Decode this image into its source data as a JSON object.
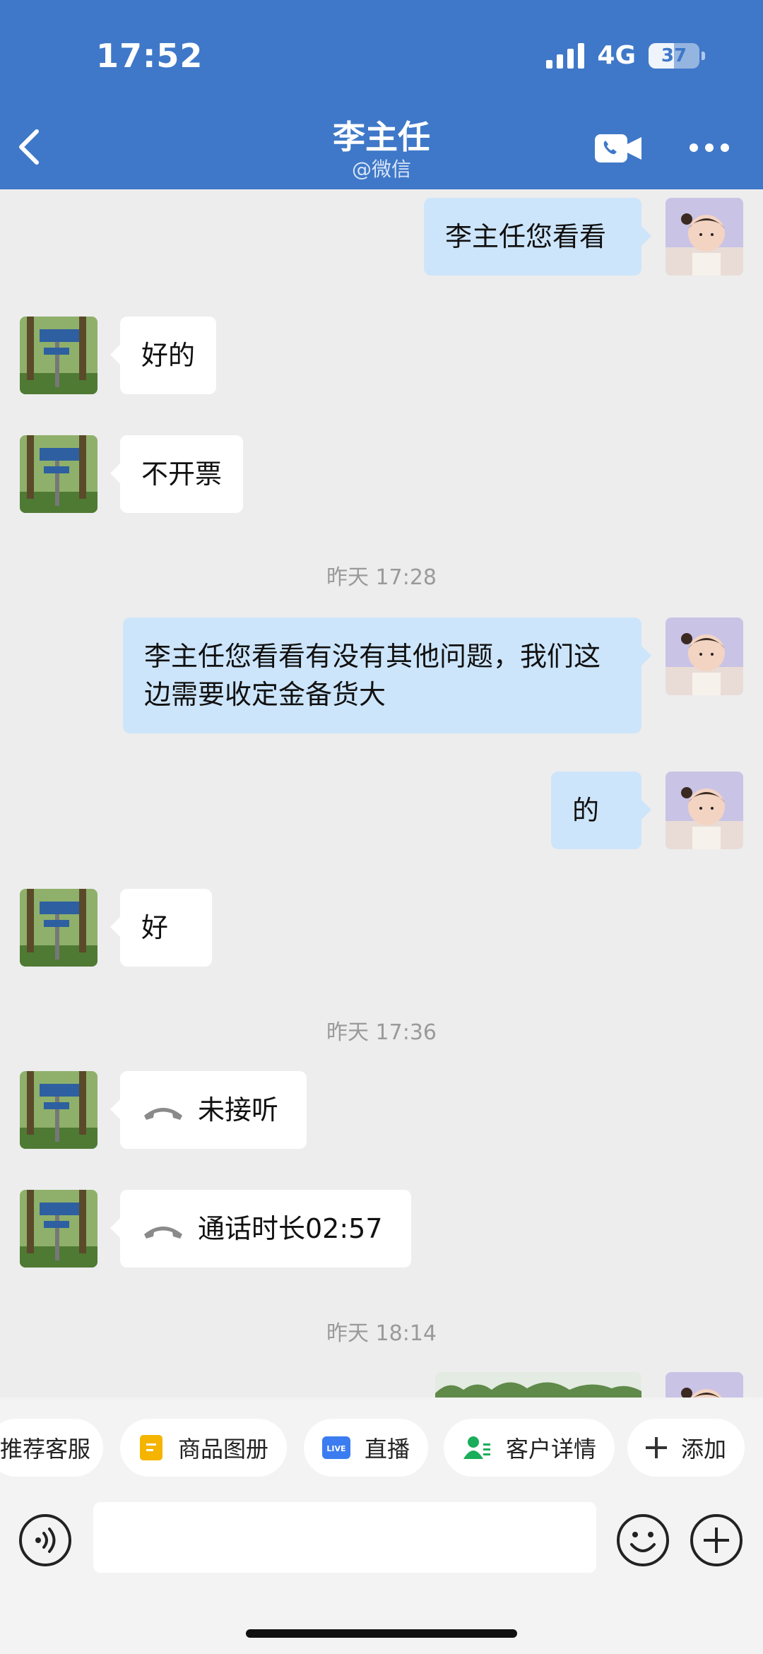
{
  "status_bar": {
    "time": "17:52",
    "network": "4G",
    "battery": "37"
  },
  "header": {
    "title": "李主任",
    "subtitle": "@微信",
    "icons": [
      "chevron-left-icon",
      "video-call-icon",
      "more-icon"
    ]
  },
  "messages": {
    "m1": {
      "text": "李主任您看看"
    },
    "m2": {
      "text": "好的"
    },
    "m3": {
      "text": "不开票"
    },
    "t1": "昨天 17:28",
    "m4": {
      "text": "李主任您看看有没有其他问题，我们这边需要收定金备货大"
    },
    "m5": {
      "text": "的"
    },
    "m6": {
      "text": "好"
    },
    "t2": "昨天 17:36",
    "m7": {
      "text": "未接听"
    },
    "m8": {
      "text": "通话时长02:57"
    },
    "t3": "昨天 18:14"
  },
  "quick_actions": {
    "a1": "推荐客服",
    "a2": "商品图册",
    "a3": "直播",
    "a4": "客户详情",
    "a5": "添加",
    "live_badge": "LIVE"
  },
  "input": {
    "placeholder": ""
  },
  "colors": {
    "header": "#3f78c8",
    "outgoing_bubble": "#cde5fb",
    "incoming_bubble": "#ffffff",
    "background": "#ededed"
  }
}
